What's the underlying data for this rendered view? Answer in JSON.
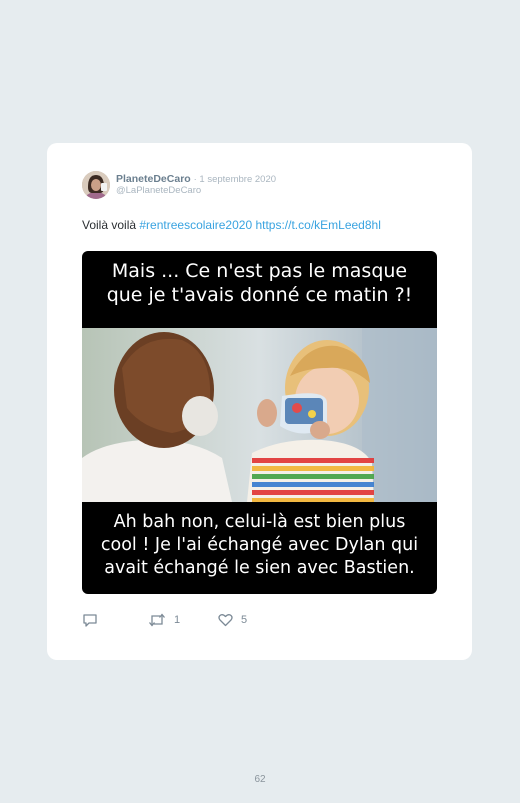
{
  "tweet": {
    "author_name": "PlaneteDeCaro",
    "date": "· 1 septembre 2020",
    "handle": "@LaPlaneteDeCaro",
    "text_plain": "Voilà voilà ",
    "hashtag": "#rentreescolaire2020",
    "link": " https://t.co/kEmLeed8hl",
    "avatar_icon": "profile-photo",
    "media": {
      "top_caption": "Mais ... Ce n'est pas le masque\nque je t'avais donné ce matin ?!",
      "bottom_caption": "Ah bah non, celui-là est bien plus\ncool ! Je l'ai échangé avec Dylan qui\navait échangé le sien avec Bastien."
    },
    "actions": {
      "reply_icon": "reply-icon",
      "retweet_icon": "retweet-icon",
      "retweet_count": "1",
      "like_icon": "heart-icon",
      "like_count": "5"
    }
  },
  "page_number": "62",
  "colors": {
    "background": "#e6ecef",
    "card": "#ffffff",
    "link": "#39a3e0",
    "author": "#6b7f8f",
    "meta": "#aab6c0"
  }
}
